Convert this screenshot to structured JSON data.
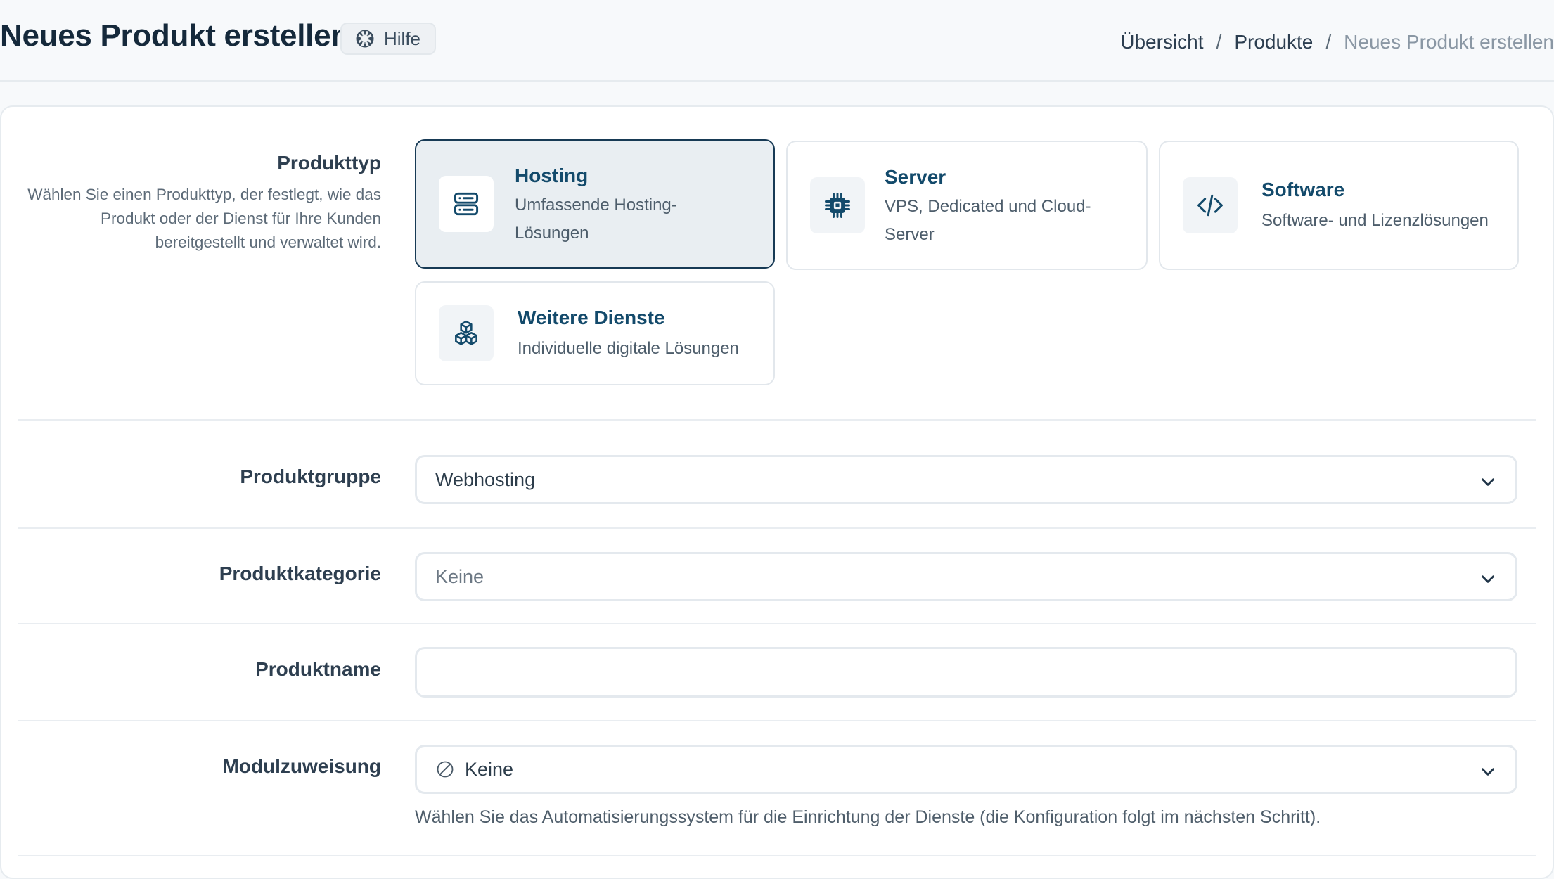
{
  "header": {
    "title": "Neues Produkt erstellen",
    "help_label": "Hilfe",
    "breadcrumb": [
      "Übersicht",
      "Produkte",
      "Neues Produkt erstellen"
    ],
    "breadcrumb_separator": "/"
  },
  "product_type": {
    "label": "Produkttyp",
    "description": "Wählen Sie einen Produkttyp, der festlegt, wie das Produkt oder der Dienst für Ihre Kunden bereitgestellt und verwaltet wird.",
    "options": [
      {
        "title": "Hosting",
        "desc": "Umfassende Hosting-Lösungen",
        "icon": "server-stack-icon",
        "selected": true
      },
      {
        "title": "Server",
        "desc": "VPS, Dedicated und Cloud-Server",
        "icon": "cpu-chip-icon",
        "selected": false
      },
      {
        "title": "Software",
        "desc": "Software- und Lizenzlösungen",
        "icon": "code-icon",
        "selected": false
      },
      {
        "title": "Weitere Dienste",
        "desc": "Individuelle digitale Lösungen",
        "icon": "cubes-icon",
        "selected": false
      }
    ]
  },
  "product_group": {
    "label": "Produktgruppe",
    "value": "Webhosting"
  },
  "product_category": {
    "label": "Produktkategorie",
    "value": "Keine"
  },
  "product_name": {
    "label": "Produktname",
    "value": "",
    "placeholder": ""
  },
  "module": {
    "label": "Modulzuweisung",
    "value": "Keine",
    "icon": "ban-icon",
    "help": "Wählen Sie das Automatisierungssystem für die Einrichtung der Dienste (die Konfiguration folgt im nächsten Schritt)."
  },
  "colors": {
    "accent": "#134a6b",
    "selected_border": "#173a55",
    "selected_bg": "#e9eef2"
  }
}
